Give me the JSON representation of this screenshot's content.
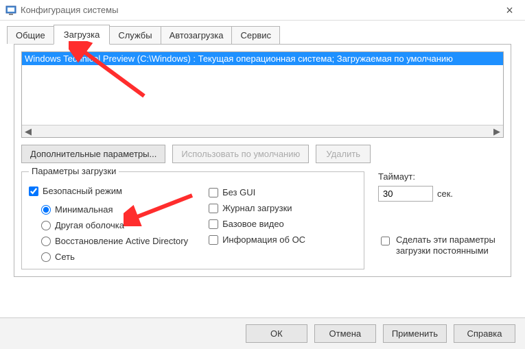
{
  "window": {
    "title": "Конфигурация системы"
  },
  "tabs": {
    "general": "Общие",
    "boot": "Загрузка",
    "services": "Службы",
    "startup": "Автозагрузка",
    "tools": "Сервис"
  },
  "oslist": {
    "selected": "Windows Technical Preview (C:\\Windows) : Текущая операционная система; Загружаемая по умолчанию"
  },
  "buttons": {
    "advanced": "Дополнительные параметры...",
    "set_default": "Использовать по умолчанию",
    "delete": "Удалить"
  },
  "boot_options": {
    "legend": "Параметры загрузки",
    "safeboot": "Безопасный режим",
    "minimal": "Минимальная",
    "altshell": "Другая оболочка",
    "dsrepair": "Восстановление Active Directory",
    "network": "Сеть",
    "noguiboot": "Без GUI",
    "bootlog": "Журнал загрузки",
    "basevideo": "Базовое видео",
    "osinfo": "Информация  об ОС"
  },
  "timeout": {
    "label": "Таймаут:",
    "value": "30",
    "unit": "сек."
  },
  "persist": {
    "label": "Сделать эти параметры загрузки постоянными"
  },
  "footer": {
    "ok": "ОК",
    "cancel": "Отмена",
    "apply": "Применить",
    "help": "Справка"
  }
}
